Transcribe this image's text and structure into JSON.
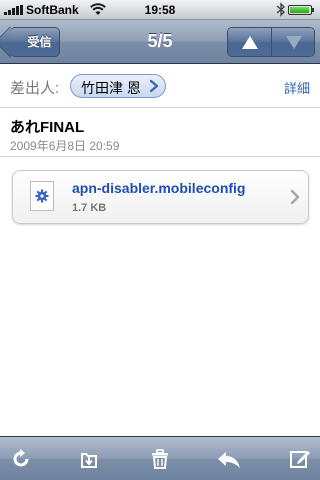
{
  "status_bar": {
    "carrier": "SoftBank",
    "time": "19:58",
    "icons": [
      "signal-icon",
      "wifi-icon",
      "bluetooth-icon",
      "battery-icon"
    ]
  },
  "nav": {
    "back_label": "受信",
    "title": "5/5",
    "prev_icon": "up-arrow-icon",
    "next_icon": "down-arrow-icon"
  },
  "header": {
    "from_label": "差出人:",
    "from_name": "竹田津 恩",
    "details_label": "詳細",
    "subject": "あれFINAL",
    "date": "2009年6月8日 20:59"
  },
  "attachment": {
    "filename": "apn-disabler.mobileconfig",
    "size": "1.7 KB",
    "icon": "gear-icon"
  },
  "toolbar": {
    "icons": [
      "refresh-icon",
      "move-to-folder-icon",
      "trash-icon",
      "reply-icon",
      "compose-icon"
    ]
  },
  "colors": {
    "link": "#2a62b8",
    "attachment_name": "#1d4fb0",
    "nav_bar": "#7d8fa8"
  }
}
